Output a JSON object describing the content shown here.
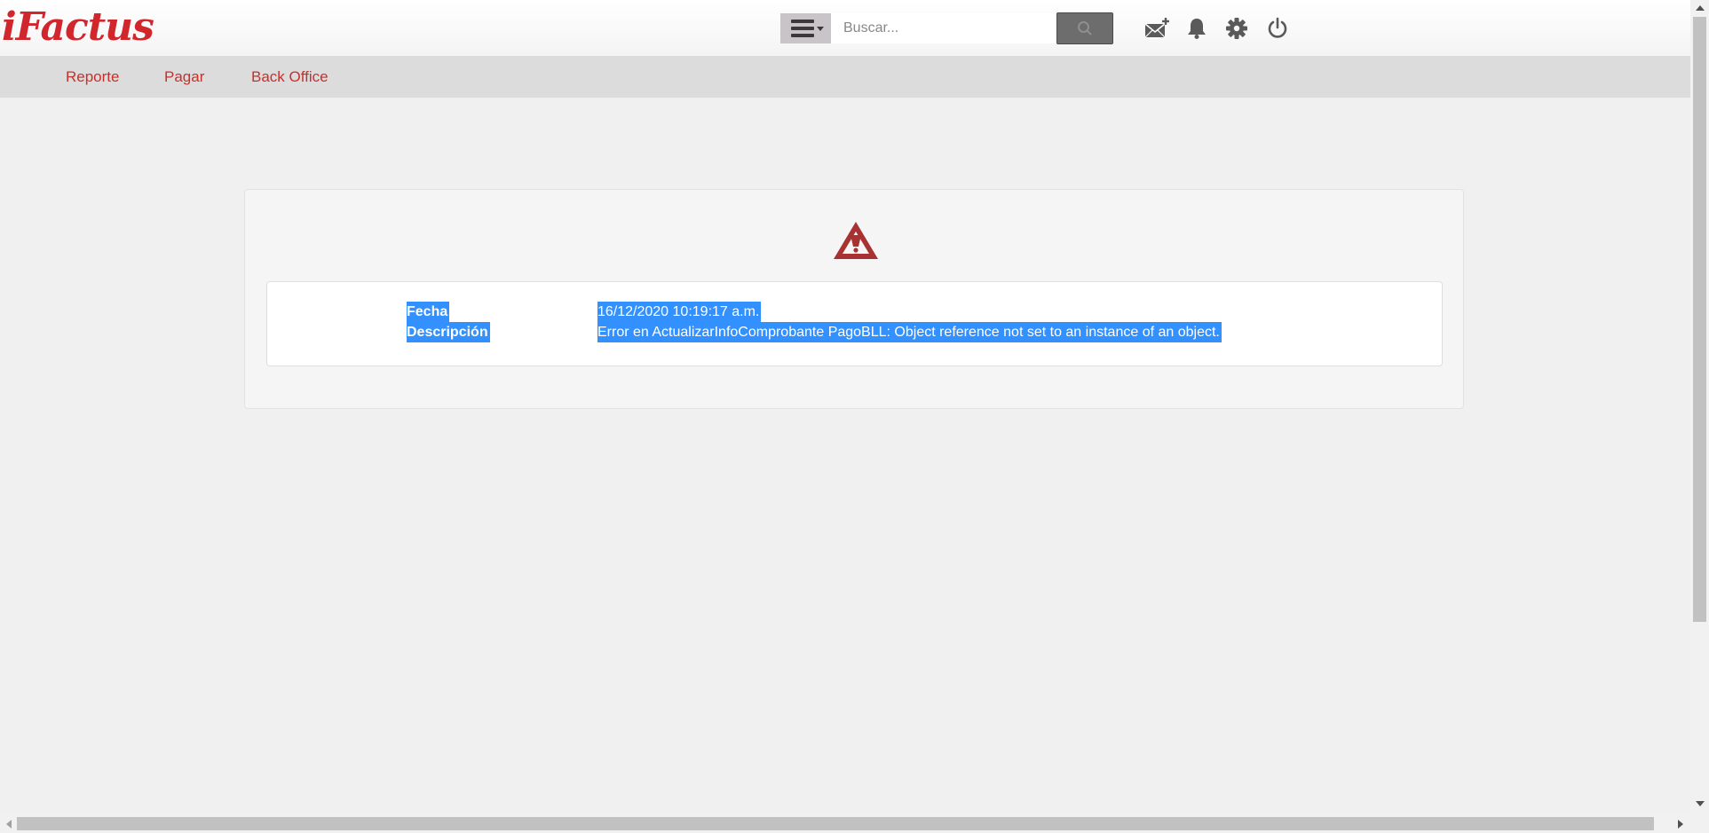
{
  "header": {
    "logo_text": "iFactus",
    "search": {
      "placeholder": "Buscar...",
      "value": ""
    },
    "icons": [
      "menu-icon",
      "search-icon",
      "mail-add-icon",
      "bell-icon",
      "gear-icon",
      "power-icon"
    ]
  },
  "nav": {
    "items": [
      {
        "label": "Reporte"
      },
      {
        "label": "Pagar"
      },
      {
        "label": "Back Office"
      }
    ]
  },
  "error": {
    "icon": "warning-icon",
    "fields": [
      {
        "label": "Fecha",
        "value": "16/12/2020 10:19:17 a.m."
      },
      {
        "label": "Descripción",
        "value": "Error en ActualizarInfoComprobante PagoBLL: Object reference not set to an instance of an object."
      }
    ]
  },
  "colors": {
    "brand": "#d0262c",
    "nav_link": "#c8302c",
    "warning": "#a83232",
    "selection": "#3390ff"
  }
}
